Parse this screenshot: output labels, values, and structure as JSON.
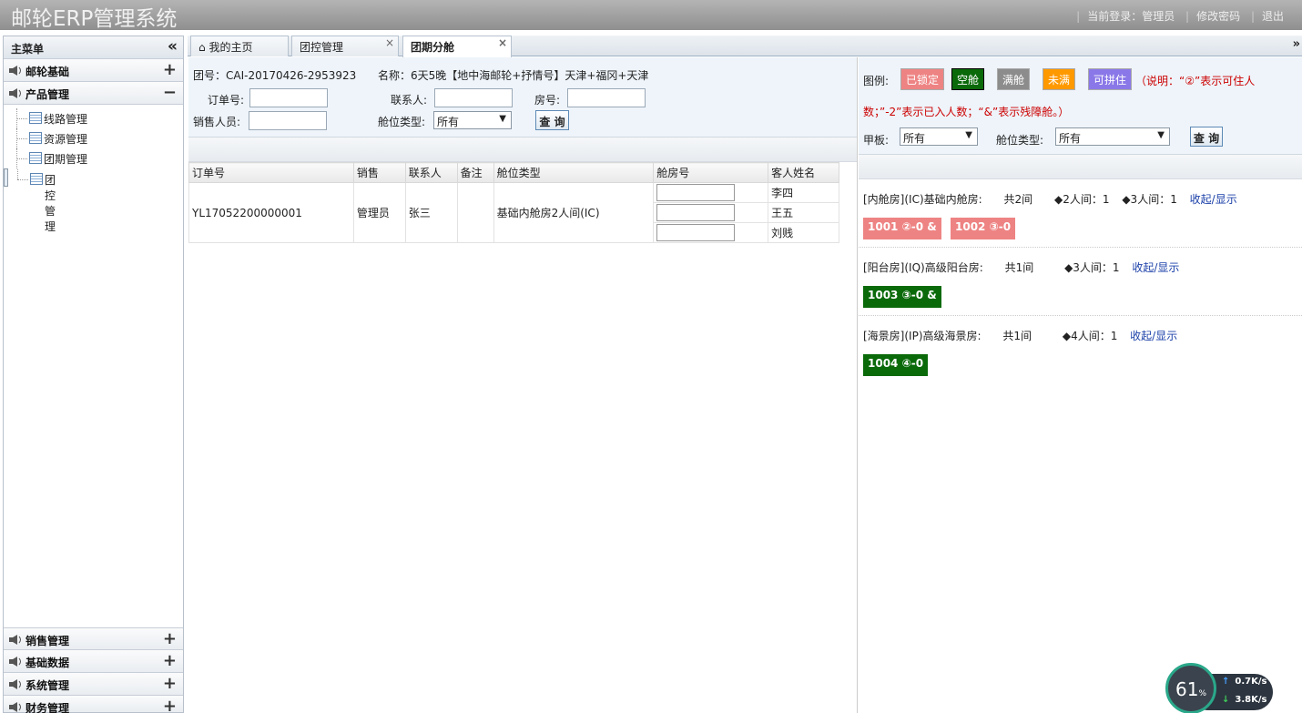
{
  "header": {
    "title": "邮轮ERP管理系统",
    "login_label": "当前登录：管理员",
    "change_pwd": "修改密码",
    "logout": "退出"
  },
  "sidebar": {
    "title": "主菜单",
    "collapse_glyph": "«",
    "groups_top": [
      {
        "label": "邮轮基础",
        "toggle": "+"
      },
      {
        "label": "产品管理",
        "toggle": "−"
      }
    ],
    "subitems": [
      "线路管理",
      "资源管理",
      "团期管理",
      "团控管理"
    ],
    "groups_bottom": [
      {
        "label": "销售管理",
        "toggle": "+"
      },
      {
        "label": "基础数据",
        "toggle": "+"
      },
      {
        "label": "系统管理",
        "toggle": "+"
      },
      {
        "label": "财务管理",
        "toggle": "+"
      }
    ]
  },
  "tabs": [
    {
      "label": "我的主页",
      "icon": "home-icon"
    },
    {
      "label": "团控管理",
      "close": "×"
    },
    {
      "label": "团期分舱",
      "close": "×"
    }
  ],
  "tab_scroll_glyph": "»",
  "filter": {
    "group_no": "团号：CAI-20170426-2953923",
    "name": "名称：6天5晚【地中海邮轮+抒情号】天津+福冈+天津",
    "order_no_label": "订单号:",
    "contact_label": "联系人:",
    "room_no_label": "房号:",
    "sales_label": "销售人员:",
    "cabin_type_label": "舱位类型:",
    "cabin_type_value": "所有",
    "query": "查 询"
  },
  "table": {
    "headers": [
      "订单号",
      "销售",
      "联系人",
      "备注",
      "舱位类型",
      "舱房号",
      "客人姓名"
    ],
    "row": {
      "order_no": "YL17052200000001",
      "sales": "管理员",
      "contact": "张三",
      "remark": "",
      "cabin_type": "基础内舱房2人间(IC)",
      "guests": [
        "李四",
        "王五",
        "刘贱"
      ]
    }
  },
  "legend": {
    "label": "图例:",
    "items": [
      {
        "label": "已锁定",
        "color": "#ee8383"
      },
      {
        "label": "空舱",
        "color": "#0a6a0a"
      },
      {
        "label": "满舱",
        "color": "#8c8c8c"
      },
      {
        "label": "未满",
        "color": "#ff9900"
      },
      {
        "label": "可拼住",
        "color": "#8a78e8"
      }
    ],
    "note1": "（说明：“②”表示可住人",
    "note2": "数；”-2”表示已入人数；“&”表示残障舱。）",
    "deck_label": "甲板:",
    "deck_value": "所有",
    "cabin_type_label": "舱位类型:",
    "cabin_type_value": "所有",
    "query": "查 询"
  },
  "rooms": [
    {
      "title": "[内舱房](IC)基础内舱房:",
      "total": "共2间",
      "stats": [
        "◆2人间：1",
        "◆3人间：1"
      ],
      "toggle": "收起/显示",
      "chips": [
        {
          "label": "1001 ②-0 &",
          "status": "locked"
        },
        {
          "label": "1002 ③-0",
          "status": "locked"
        }
      ]
    },
    {
      "title": "[阳台房](IQ)高级阳台房:",
      "total": "共1间",
      "stats": [
        "◆3人间：1"
      ],
      "toggle": "收起/显示",
      "chips": [
        {
          "label": "1003 ③-0 &",
          "status": "empty"
        }
      ]
    },
    {
      "title": "[海景房](IP)高级海景房:",
      "total": "共1间",
      "stats": [
        "◆4人间：1"
      ],
      "toggle": "收起/显示",
      "chips": [
        {
          "label": "1004 ④-0",
          "status": "empty"
        }
      ]
    }
  ],
  "widget": {
    "percent": "61",
    "percent_unit": "%",
    "up": "0.7",
    "down": "3.8",
    "unit": "K/s"
  }
}
